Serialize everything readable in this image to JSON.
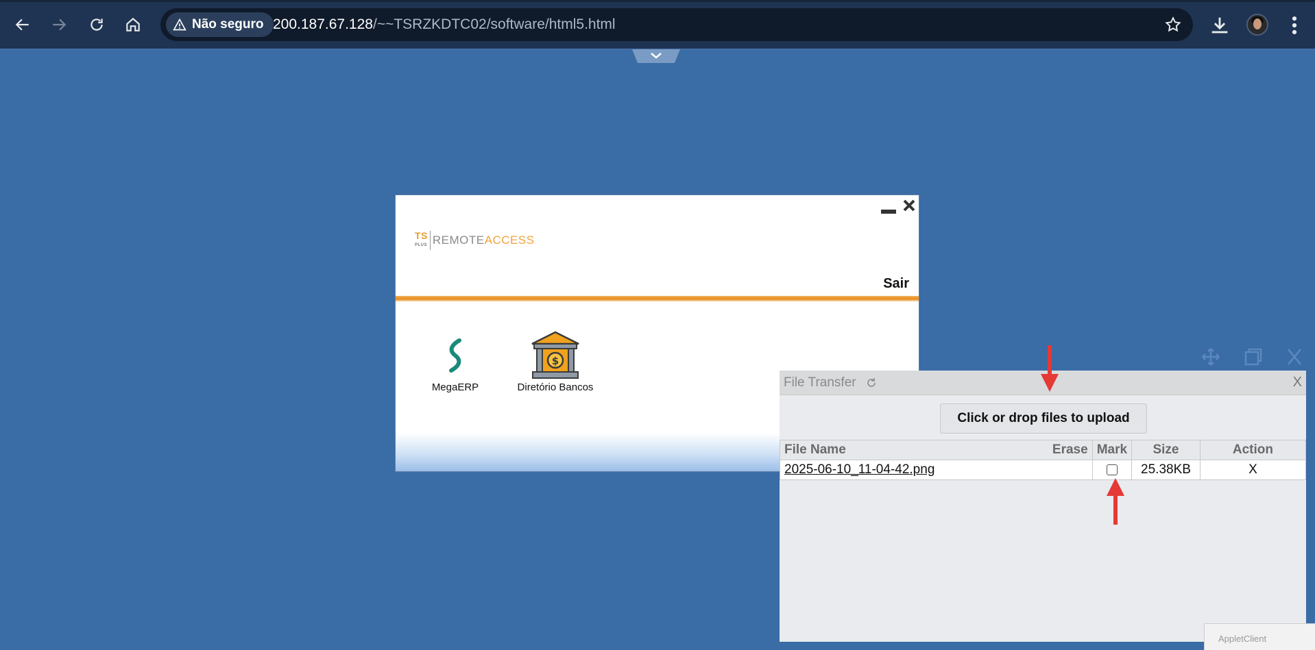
{
  "browser": {
    "security_label": "Não seguro",
    "url_host": "200.187.67.128",
    "url_path": "/~~TSRZKDTC02/software/html5.html"
  },
  "launcher": {
    "logo_ts": "TS",
    "logo_plus": "PLUS",
    "logo_remote": "REMOTE",
    "logo_access": "ACCESS",
    "exit_label": "Sair",
    "apps": [
      {
        "label": "MegaERP",
        "icon": "megaerp-logo-icon"
      },
      {
        "label": "Diretório Bancos",
        "icon": "bank-building-icon"
      }
    ]
  },
  "file_transfer": {
    "title": "File Transfer",
    "close_label": "X",
    "upload_label": "Click or drop files to upload",
    "columns": {
      "file_name": "File Name",
      "erase": "Erase",
      "mark": "Mark",
      "size": "Size",
      "action": "Action"
    },
    "files": [
      {
        "name": "2025-06-10_11-04-42.png",
        "marked": false,
        "size": "25.38KB",
        "action": "X"
      }
    ]
  },
  "annotation_color": "#e53935",
  "applet_stub_text": "AppletClient"
}
